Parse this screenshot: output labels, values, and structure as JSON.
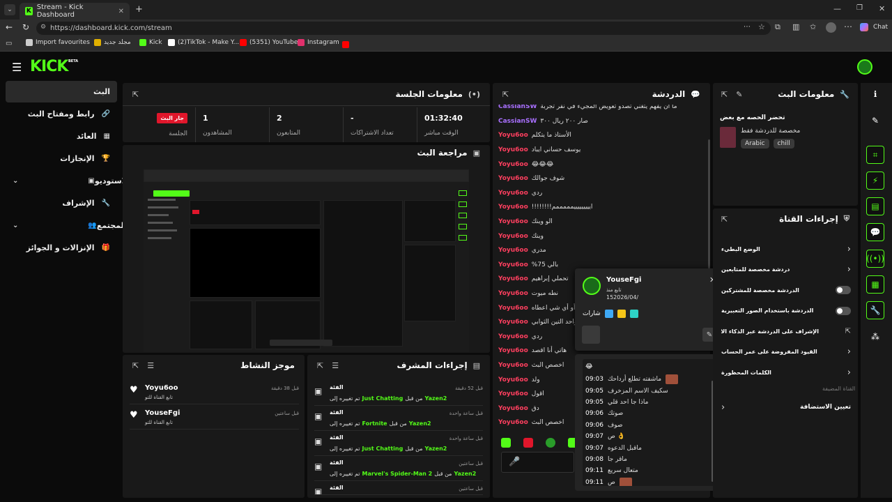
{
  "browser": {
    "tab_title": "Stream - Kick Dashboard",
    "url": "https://dashboard.kick.com/stream",
    "chat_label": "Chat",
    "bookmarks": [
      {
        "label": "Import favourites",
        "color": "#cccccc"
      },
      {
        "label": "مجلد جديد",
        "color": "#e0b000"
      },
      {
        "label": "Kick",
        "color": "#53fc18"
      },
      {
        "label": "(2)TikTok - Make Y...",
        "color": "#ffffff"
      },
      {
        "label": "(5351) YouTube",
        "color": "#ff0000"
      },
      {
        "label": "Instagram",
        "color": "#e1306c"
      }
    ]
  },
  "app": {
    "logo": "KICK",
    "beta": "BETA",
    "sidebar": [
      {
        "label": "البث",
        "icon": "none"
      },
      {
        "label": "رابط ومفتاح البث",
        "icon": "link-icon"
      },
      {
        "label": "العائد",
        "icon": "wallet-icon"
      },
      {
        "label": "الإنجازات",
        "icon": "trophy-icon"
      },
      {
        "label": "الاستوديو",
        "icon": "studio-icon"
      },
      {
        "label": "الإشراف",
        "icon": "wrench-icon"
      },
      {
        "label": "المجتمع",
        "icon": "community-icon"
      },
      {
        "label": "الإنزالات و الجوائز",
        "icon": "gift-icon"
      }
    ]
  },
  "session": {
    "title": "معلومات الجلسة",
    "live_badge": "جار البث",
    "live_label": "الجلسة",
    "stats": [
      {
        "value": "1",
        "label": "المشاهدون"
      },
      {
        "value": "2",
        "label": "المتابعون"
      },
      {
        "value": "-",
        "label": "تعداد الاشتراكات"
      },
      {
        "value": "01:32:40",
        "label": "الوقت مباشر"
      }
    ]
  },
  "preview": {
    "title": "مراجعة البث"
  },
  "activity": {
    "title": "موجز النشاط",
    "items": [
      {
        "user": "Yoyu6oo",
        "desc": "تابع القناة للتو",
        "time": "قبل 38 دقيقة"
      },
      {
        "user": "YouseFgi",
        "desc": "تابع القناة للتو",
        "time": "قبل ساعتين"
      }
    ]
  },
  "mod_actions": {
    "title": "إجراءات المشرف",
    "items": [
      {
        "heading": "الفئة",
        "time": "قبل 52 دقيقة",
        "user": "Yazen2",
        "mid": "من قبل",
        "value": "Just Chatting",
        "suffix": "تم تغييره إلى"
      },
      {
        "heading": "الفئة",
        "time": "قبل ساعة واحدة",
        "user": "Yazen2",
        "mid": "من قبل",
        "value": "Fortnite",
        "suffix": "تم تغييره إلى"
      },
      {
        "heading": "الفئة",
        "time": "قبل ساعة واحدة",
        "user": "Yazen2",
        "mid": "من قبل",
        "value": "Just Chatting",
        "suffix": "تم تغييره إلى"
      },
      {
        "heading": "الفئة",
        "time": "قبل ساعتين",
        "user": "Yazen2",
        "mid": "من قبل",
        "value": "Marvel's Spider-Man 2",
        "suffix": "تم تغييره إلى"
      },
      {
        "heading": "الفئة",
        "time": "قبل ساعتين",
        "user": "",
        "mid": "",
        "value": "",
        "suffix": ""
      }
    ]
  },
  "chat": {
    "title": "الدردشة",
    "messages": [
      {
        "user": "CassianSW",
        "text": "ما ان يفهم يتغني تصدو تعويض المجيء في نفر تجربة",
        "color": "#a970ff"
      },
      {
        "user": "CassianSW",
        "text": "صار ٢٠٠ ريال ٣٠٠",
        "color": "#a970ff"
      },
      {
        "user": "Yoyu6oo",
        "text": "الأستاذ ما يتكلم",
        "color": "#ff3f5f"
      },
      {
        "user": "Yoyu6oo",
        "text": "يوسف حساني ايباد",
        "color": "#ff3f5f"
      },
      {
        "user": "Yoyu6oo",
        "text": "😂😂😂",
        "color": "#ff3f5f"
      },
      {
        "user": "Yoyu6oo",
        "text": "شوف جوالك",
        "color": "#ff3f5f"
      },
      {
        "user": "Yoyu6oo",
        "text": "ردي",
        "color": "#ff3f5f"
      },
      {
        "user": "Yoyu6oo",
        "text": "!!!!!!!!ايييييييييمممممم",
        "color": "#ff3f5f"
      },
      {
        "user": "Yoyu6oo",
        "text": "الو وينك",
        "color": "#ff3f5f"
      },
      {
        "user": "Yoyu6oo",
        "text": "وينك",
        "color": "#ff3f5f"
      },
      {
        "user": "Yoyu6oo",
        "text": "مدري",
        "color": "#ff3f5f"
      },
      {
        "user": "Yoyu6oo",
        "text": "%بالي 75",
        "color": "#ff3f5f"
      },
      {
        "user": "Yoyu6oo",
        "text": "تحملي إبراهيم",
        "color": "#ff3f5f"
      },
      {
        "user": "Yoyu6oo",
        "text": "نطه ميوت",
        "color": "#ff3f5f"
      },
      {
        "user": "Yoyu6oo",
        "text": "أو أي شي اعطاه",
        "color": "#ff3f5f"
      },
      {
        "user": "Yoyu6oo",
        "text": "واحد التين الثوابي",
        "color": "#ff3f5f"
      },
      {
        "user": "Yoyu6oo",
        "text": "ردي",
        "color": "#ff3f5f"
      },
      {
        "user": "Yoyu6oo",
        "text": "هاتي أنا اقصد",
        "color": "#ff3f5f"
      },
      {
        "user": "Yoyu6oo",
        "text": "اخصص البث",
        "color": "#ff3f5f"
      },
      {
        "user": "Yoyu6oo",
        "text": "ولد",
        "color": "#ff3f5f"
      },
      {
        "user": "Yoyu6oo",
        "text": "اقول",
        "color": "#ff3f5f"
      },
      {
        "user": "Yoyu6oo",
        "text": "دق",
        "color": "#ff3f5f"
      },
      {
        "user": "Yoyu6oo",
        "text": "اخصص البث",
        "color": "#ff3f5f"
      }
    ]
  },
  "user_card": {
    "name": "YouseFgi",
    "label": "تابع منذ",
    "date": "152026/04/",
    "badges_label": "شارات"
  },
  "timed_chat": [
    {
      "time": "09:03",
      "text": "ماشفته تطلع أرداحك"
    },
    {
      "time": "09:05",
      "text": "سكيف الاسم المزخرف"
    },
    {
      "time": "09:05",
      "text": "ماذا جا احد قلي"
    },
    {
      "time": "09:06",
      "text": "صوتك"
    },
    {
      "time": "09:06",
      "text": "صوف"
    },
    {
      "time": "09:07",
      "text": "ص 👌"
    },
    {
      "time": "09:07",
      "text": "ماقبل الدعوه"
    },
    {
      "time": "09:08",
      "text": "ماقر جا"
    },
    {
      "time": "09:11",
      "text": "متعال سريع"
    },
    {
      "time": "09:11",
      "text": "ص"
    }
  ],
  "stream_info": {
    "title": "معلومات البث",
    "stream_title": "تحضر الحصه مع بعض",
    "category": "مخصصة للدردشة فقط",
    "tags": [
      "Arabic",
      "chill"
    ]
  },
  "channel_actions": {
    "title": "إجراءات القناة",
    "items": [
      {
        "label": "الوضع البطيء",
        "control": "chevron"
      },
      {
        "label": "دردشة مخصصة للمتابعين",
        "control": "chevron"
      },
      {
        "label": "الدردشة مخصصة للمشتركين",
        "control": "toggle"
      },
      {
        "label": "الدردشة باستخدام الصور التعبيرية",
        "control": "toggle"
      },
      {
        "label": "الإشراف على الدردشة عبر الذكاء الاصطناعي",
        "control": "external"
      },
      {
        "label": "القيود المفروضة على عمر الحساب",
        "control": "chevron"
      },
      {
        "label": "الكلمات المحظورة",
        "control": "chevron"
      }
    ],
    "section_label": "القناة المضيفة",
    "host_label": "تعيين الاستضافة"
  }
}
